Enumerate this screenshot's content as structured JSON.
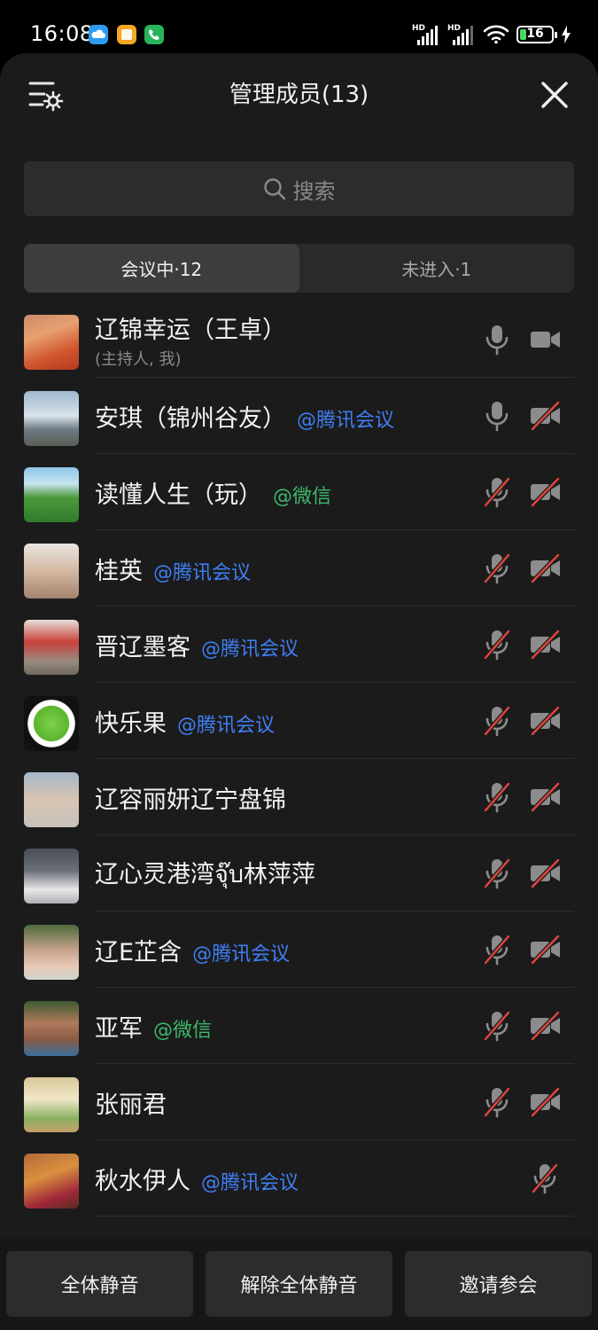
{
  "status_bar": {
    "time": "16:08",
    "battery": "16",
    "hd1": "HD",
    "hd2": "HD",
    "app_icons": [
      {
        "name": "cloud-app-icon",
        "color": "#2d9cf0"
      },
      {
        "name": "notes-app-icon",
        "color": "#f5a623"
      },
      {
        "name": "phone-app-icon",
        "color": "#27b45a"
      }
    ]
  },
  "header": {
    "title": "管理成员(13)"
  },
  "search": {
    "placeholder": "搜索"
  },
  "tabs": [
    {
      "label": "会议中·12",
      "active": true
    },
    {
      "label": "未进入·1",
      "active": false
    }
  ],
  "members": [
    {
      "name": "辽锦幸运（王卓）",
      "source": "",
      "source_type": "",
      "note": "(主持人, 我)",
      "mic": "on",
      "cam": "on"
    },
    {
      "name": "安琪（锦州谷友）",
      "source": "@腾讯会议",
      "source_type": "tencent",
      "note": "",
      "mic": "on",
      "cam": "off"
    },
    {
      "name": "读懂人生（玩）",
      "source": "@微信",
      "source_type": "wechat",
      "note": "",
      "mic": "off",
      "cam": "off"
    },
    {
      "name": "桂英",
      "source": "@腾讯会议",
      "source_type": "tencent",
      "note": "",
      "mic": "off",
      "cam": "off"
    },
    {
      "name": "晋辽墨客",
      "source": "@腾讯会议",
      "source_type": "tencent",
      "note": "",
      "mic": "off",
      "cam": "off"
    },
    {
      "name": "快乐果",
      "source": "@腾讯会议",
      "source_type": "tencent",
      "note": "",
      "mic": "off",
      "cam": "off"
    },
    {
      "name": "辽容丽妍辽宁盘锦",
      "source": "",
      "source_type": "",
      "note": "",
      "mic": "off",
      "cam": "off"
    },
    {
      "name": "辽心灵港湾จุ๊บ林萍萍",
      "source": "",
      "source_type": "",
      "note": "",
      "mic": "off",
      "cam": "off"
    },
    {
      "name": "辽E芷含",
      "source": "@腾讯会议",
      "source_type": "tencent",
      "note": "",
      "mic": "off",
      "cam": "off"
    },
    {
      "name": "亚军",
      "source": "@微信",
      "source_type": "wechat",
      "note": "",
      "mic": "off",
      "cam": "off"
    },
    {
      "name": "张丽君",
      "source": "",
      "source_type": "",
      "note": "",
      "mic": "off",
      "cam": "off"
    },
    {
      "name": "秋水伊人",
      "source": "@腾讯会议",
      "source_type": "tencent",
      "note": "",
      "mic": "off",
      "cam": "none"
    }
  ],
  "footer": {
    "mute_all": "全体静音",
    "unmute_all": "解除全体静音",
    "invite": "邀请参会"
  },
  "colors": {
    "tencent": "#3f7ff5",
    "wechat": "#3cb86a",
    "muted_slash": "#e0463c"
  }
}
